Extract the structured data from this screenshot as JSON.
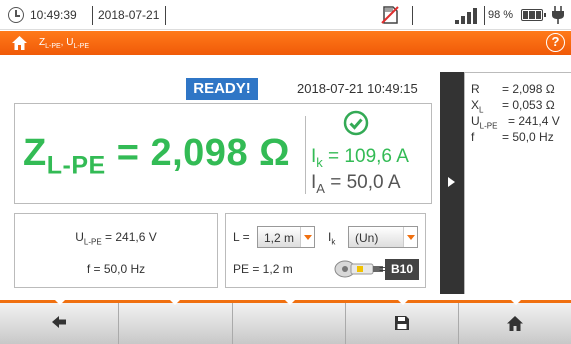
{
  "statusbar": {
    "time": "10:49:39",
    "date": "2018-07-21",
    "battery_percent": "98 %",
    "icons": [
      "clock-icon",
      "memory-card-icon",
      "signal-bars-icon",
      "battery-icon",
      "power-plug-icon"
    ]
  },
  "titlebar": {
    "title_main": "Z",
    "title_sub1": "L-PE",
    "title_sep": ", U",
    "title_sub2": "L-PE",
    "help_label": "?"
  },
  "status": {
    "ready_label": "READY!",
    "datetime": "2018-07-21 10:49:15"
  },
  "result": {
    "z_symbol": "Z",
    "z_sub": "L-PE",
    "z_value": " = 2,098 Ω",
    "ik_symbol": "I",
    "ik_sub": "k",
    "ik_value": " = 109,6 A",
    "ia_symbol": "I",
    "ia_sub": "A",
    "ia_value": " = 50,0 A"
  },
  "measurements": {
    "u_label": "U",
    "u_sub": "L-PE",
    "u_value": " = 241,6 V",
    "f_text": "f = 50,0 Hz"
  },
  "settings": {
    "l_label": "L =",
    "l_value": "1,2 m",
    "ik_label": "I",
    "ik_sub": "k",
    "ik_value": "(Un)",
    "pe_text": "PE = 1,2 m",
    "probe_eq": "=",
    "fuse_label": "B10"
  },
  "sidepanel": {
    "rows": [
      {
        "k": "R",
        "sub": "",
        "v": "= 2,098 Ω"
      },
      {
        "k": "X",
        "sub": "L",
        "v": "= 0,053 Ω"
      },
      {
        "k": "U",
        "sub": "L-PE",
        "v": "= 241,4 V"
      },
      {
        "k": "f",
        "sub": "",
        "v": "= 50,0 Hz"
      }
    ]
  },
  "toolbar": {
    "buttons": [
      "back-arrow-icon",
      "",
      "",
      "save-icon",
      "home-icon"
    ]
  },
  "colors": {
    "accent": "#f07010",
    "result_green": "#33bb55",
    "ready_blue": "#2f76c6"
  }
}
